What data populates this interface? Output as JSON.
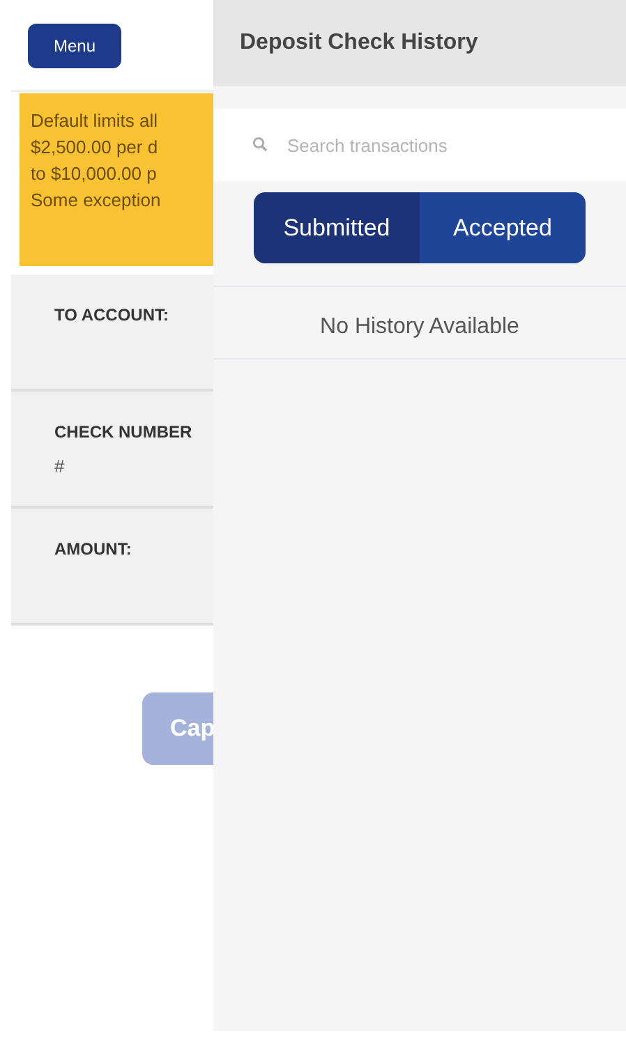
{
  "menu_button": {
    "label": "Menu"
  },
  "limits_notice": {
    "lines": [
      "Default limits all",
      "$2,500.00 per d",
      "to $10,000.00 p",
      "Some exception"
    ]
  },
  "form_fields": [
    {
      "label": "TO ACCOUNT:"
    },
    {
      "label": "CHECK NUMBER",
      "sublabel": "#"
    },
    {
      "label": "AMOUNT:"
    }
  ],
  "capture_button": {
    "label": "Cap",
    "disabled": true
  },
  "history_panel": {
    "title": "Deposit Check History",
    "search": {
      "placeholder": "Search transactions"
    },
    "tabs": [
      {
        "label": "Submitted",
        "selected": true
      },
      {
        "label": "Accepted",
        "selected": false
      }
    ],
    "empty_message": "No History Available"
  }
}
